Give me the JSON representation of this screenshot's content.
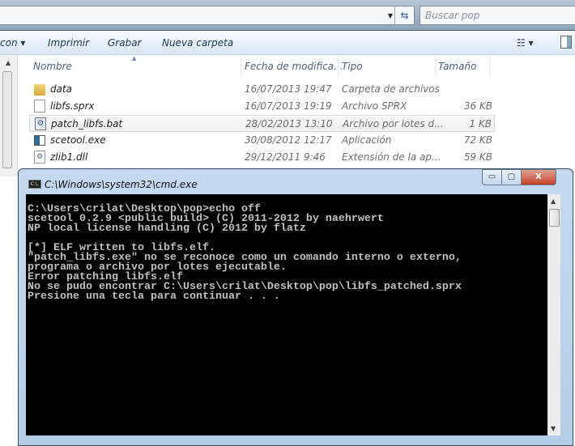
{
  "explorer": {
    "search_placeholder": "Buscar pop",
    "toolbar": {
      "organize_partial": "con ▾",
      "print": "Imprimir",
      "burn": "Grabar",
      "new_folder": "Nueva carpeta",
      "views": "☷ ▾"
    },
    "columns": {
      "name": "Nombre",
      "date": "Fecha de modifica...",
      "type": "Tipo",
      "size": "Tamaño"
    },
    "files": [
      {
        "name": "data",
        "date": "16/07/2013 19:47",
        "type": "Carpeta de archivos",
        "size": "",
        "icon": "folder"
      },
      {
        "name": "libfs.sprx",
        "date": "16/07/2013 19:19",
        "type": "Archivo SPRX",
        "size": "36 KB",
        "icon": "file"
      },
      {
        "name": "patch_libfs.bat",
        "date": "28/02/2013 13:10",
        "type": "Archivo por lotes d...",
        "size": "1 KB",
        "icon": "batch"
      },
      {
        "name": "scetool.exe",
        "date": "30/08/2012 12:17",
        "type": "Aplicación",
        "size": "72 KB",
        "icon": "exe"
      },
      {
        "name": "zlib1.dll",
        "date": "29/12/2011 9:46",
        "type": "Extensión de la ap...",
        "size": "59 KB",
        "icon": "dll"
      }
    ]
  },
  "cmd": {
    "title": "C:\\Windows\\system32\\cmd.exe",
    "icon_text": "C:\\.",
    "buttons": {
      "minimize": "▭",
      "maximize": "▢",
      "close": "X"
    },
    "lines": [
      "C:\\Users\\crilat\\Desktop\\pop>echo off",
      "scetool 0.2.9 <public build> (C) 2011-2012 by naehrwert",
      "NP local license handling (C) 2012 by flatz",
      "",
      "[*] ELF written to libfs.elf.",
      "\"patch_libfs.exe\" no se reconoce como un comando interno o externo,",
      "programa o archivo por lotes ejecutable.",
      "Error patching libfs.elf",
      "No se pudo encontrar C:\\Users\\crilat\\Desktop\\pop\\libfs_patched.sprx",
      "Presione una tecla para continuar . . ."
    ]
  }
}
